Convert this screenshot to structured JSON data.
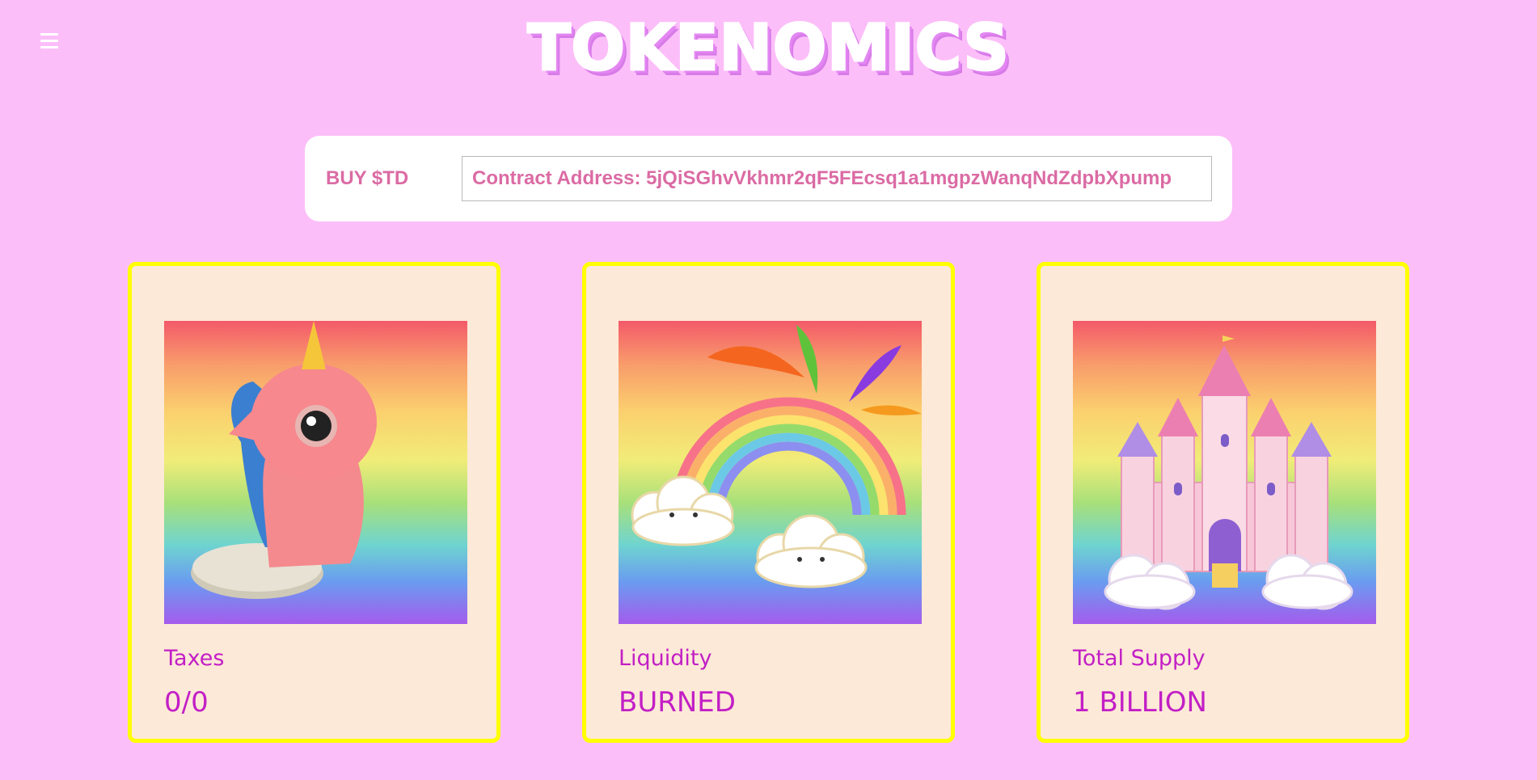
{
  "header": {
    "title": "TOKENOMICS",
    "menu_icon": "hamburger-menu-icon"
  },
  "buy_bar": {
    "label": "BUY $TD",
    "contract_value": "Contract Address: 5jQiSGhvVkhmr2qF5FEcsq1a1mgpzWanqNdZdpbXpump"
  },
  "cards": [
    {
      "label": "Taxes",
      "value": "0/0",
      "image": "unicorn-figurine-image"
    },
    {
      "label": "Liquidity",
      "value": "BURNED",
      "image": "rainbow-clouds-image"
    },
    {
      "label": "Total Supply",
      "value": "1 BILLION",
      "image": "pink-castle-image"
    }
  ],
  "colors": {
    "background": "#fcbef9",
    "card_background": "#fde9d7",
    "card_border": "#ffff00",
    "card_text": "#c21fc6",
    "buy_text": "#db6ba4"
  }
}
